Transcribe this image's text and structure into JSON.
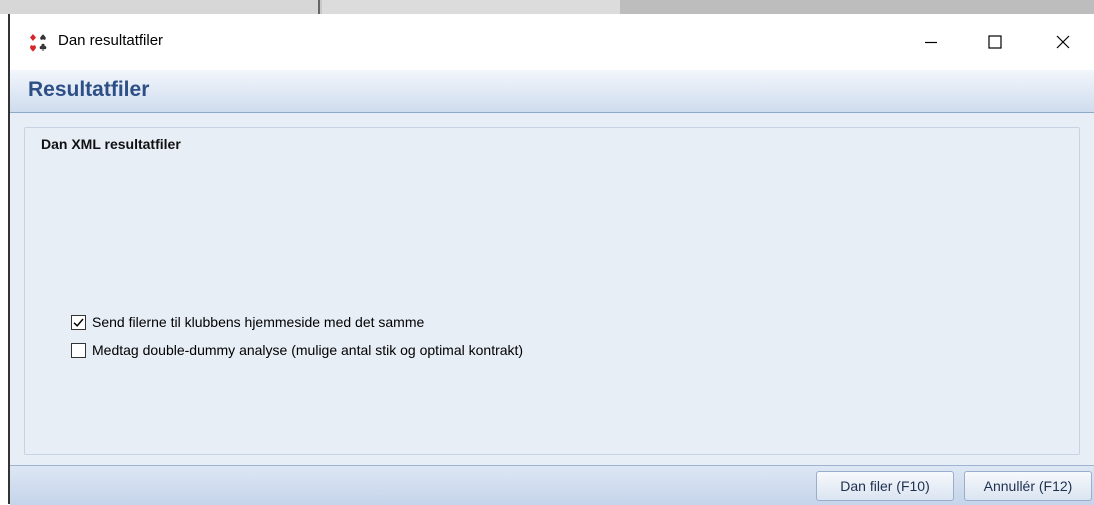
{
  "window": {
    "title": "Dan resultatfiler"
  },
  "header": {
    "title": "Resultatfiler"
  },
  "group": {
    "title": "Dan XML resultatfiler"
  },
  "options": [
    {
      "label": "Send filerne til klubbens hjemmeside med det samme",
      "checked": true
    },
    {
      "label": "Medtag double-dummy analyse (mulige antal stik og optimal kontrakt)",
      "checked": false
    }
  ],
  "buttons": {
    "create": "Dan filer (F10)",
    "cancel": "Annullér (F12)"
  },
  "colors": {
    "header_text": "#2d4f86",
    "body_bg": "#e8eef6",
    "suit_red": "#d6262b",
    "suit_dark": "#333333"
  }
}
